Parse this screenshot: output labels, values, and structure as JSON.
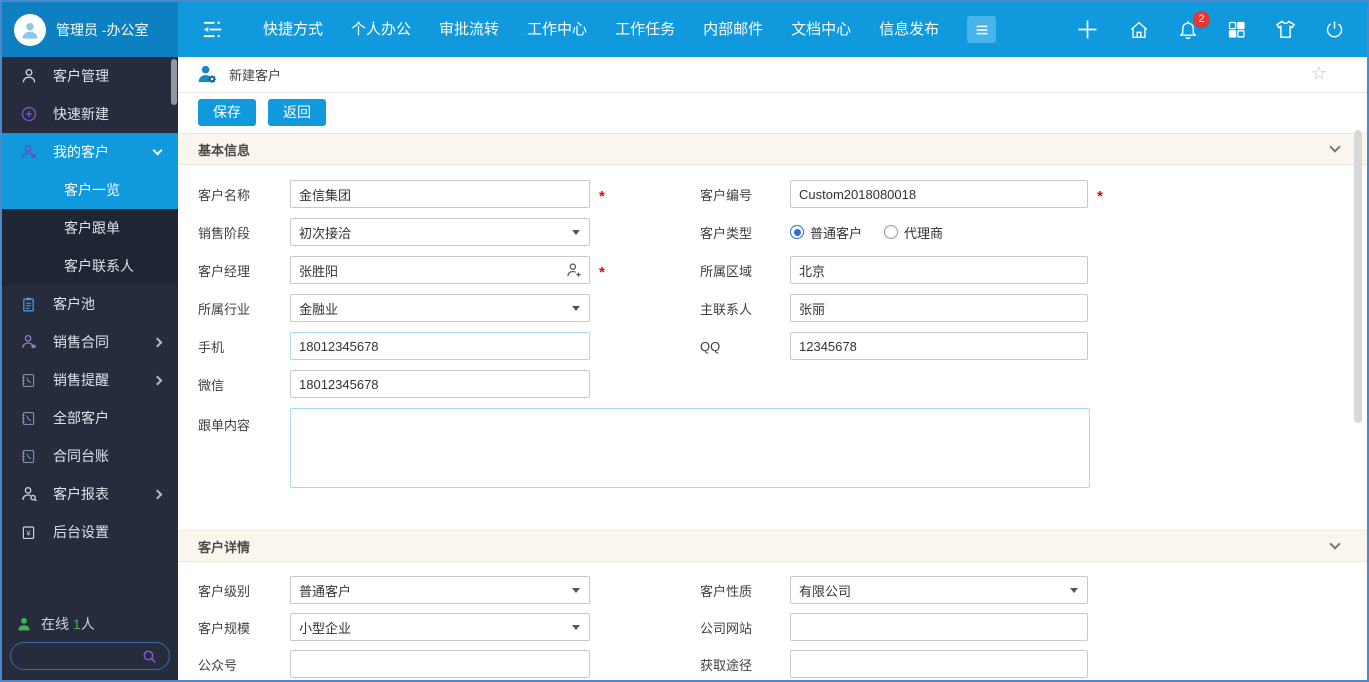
{
  "colors": {
    "header_blue": "#1199dd",
    "header_dark_blue": "#0d80c2",
    "sidebar_dark": "#262c3c",
    "active_blue": "#1199dd",
    "section_beige": "#faf5ed",
    "badge_red": "#e8352e",
    "online_green": "#3cb54a",
    "required_red": "#e8000d"
  },
  "icons": {
    "favorite_star": "☆"
  },
  "header": {
    "user": {
      "name": "管理员 -办公室"
    },
    "nav": [
      "快捷方式",
      "个人办公",
      "审批流转",
      "工作中心",
      "工作任务",
      "内部邮件",
      "文档中心",
      "信息发布"
    ],
    "notification_count": "2"
  },
  "sidebar": {
    "items": [
      {
        "label": "客户管理"
      },
      {
        "label": "快速新建"
      },
      {
        "label": "我的客户"
      },
      {
        "label": "客户一览"
      },
      {
        "label": "客户跟单"
      },
      {
        "label": "客户联系人"
      },
      {
        "label": "客户池"
      },
      {
        "label": "销售合同"
      },
      {
        "label": "销售提醒"
      },
      {
        "label": "全部客户"
      },
      {
        "label": "合同台账"
      },
      {
        "label": "客户报表"
      },
      {
        "label": "后台设置"
      }
    ],
    "online": {
      "prefix": "在线",
      "count": "1",
      "suffix": "人"
    }
  },
  "page": {
    "title": "新建客户",
    "save_label": "保存",
    "back_label": "返回"
  },
  "sections": {
    "basic": "基本信息",
    "detail": "客户详情"
  },
  "form": {
    "required_marker": "*",
    "customer_name": {
      "label": "客户名称",
      "value": "金信集团"
    },
    "customer_no": {
      "label": "客户编号",
      "value": "Custom2018080018"
    },
    "sales_stage": {
      "label": "销售阶段",
      "value": "初次接洽"
    },
    "customer_type": {
      "label": "客户类型",
      "options": [
        "普通客户",
        "代理商"
      ],
      "selected": "普通客户"
    },
    "customer_manager": {
      "label": "客户经理",
      "value": "张胜阳"
    },
    "region": {
      "label": "所属区域",
      "value": "北京"
    },
    "industry": {
      "label": "所属行业",
      "value": "金融业"
    },
    "main_contact": {
      "label": "主联系人",
      "value": "张丽"
    },
    "mobile": {
      "label": "手机",
      "value": "18012345678"
    },
    "qq": {
      "label": "QQ",
      "value": "12345678"
    },
    "wechat": {
      "label": "微信",
      "value": "18012345678"
    },
    "follow_content": {
      "label": "跟单内容",
      "value": ""
    },
    "customer_level": {
      "label": "客户级别",
      "value": "普通客户"
    },
    "customer_nature": {
      "label": "客户性质",
      "value": "有限公司"
    },
    "customer_scale": {
      "label": "客户规模",
      "value": "小型企业"
    },
    "company_website": {
      "label": "公司网站",
      "value": ""
    },
    "official_account": {
      "label": "公众号",
      "value": ""
    },
    "acquisition_channel": {
      "label": "获取途径",
      "value": ""
    }
  }
}
